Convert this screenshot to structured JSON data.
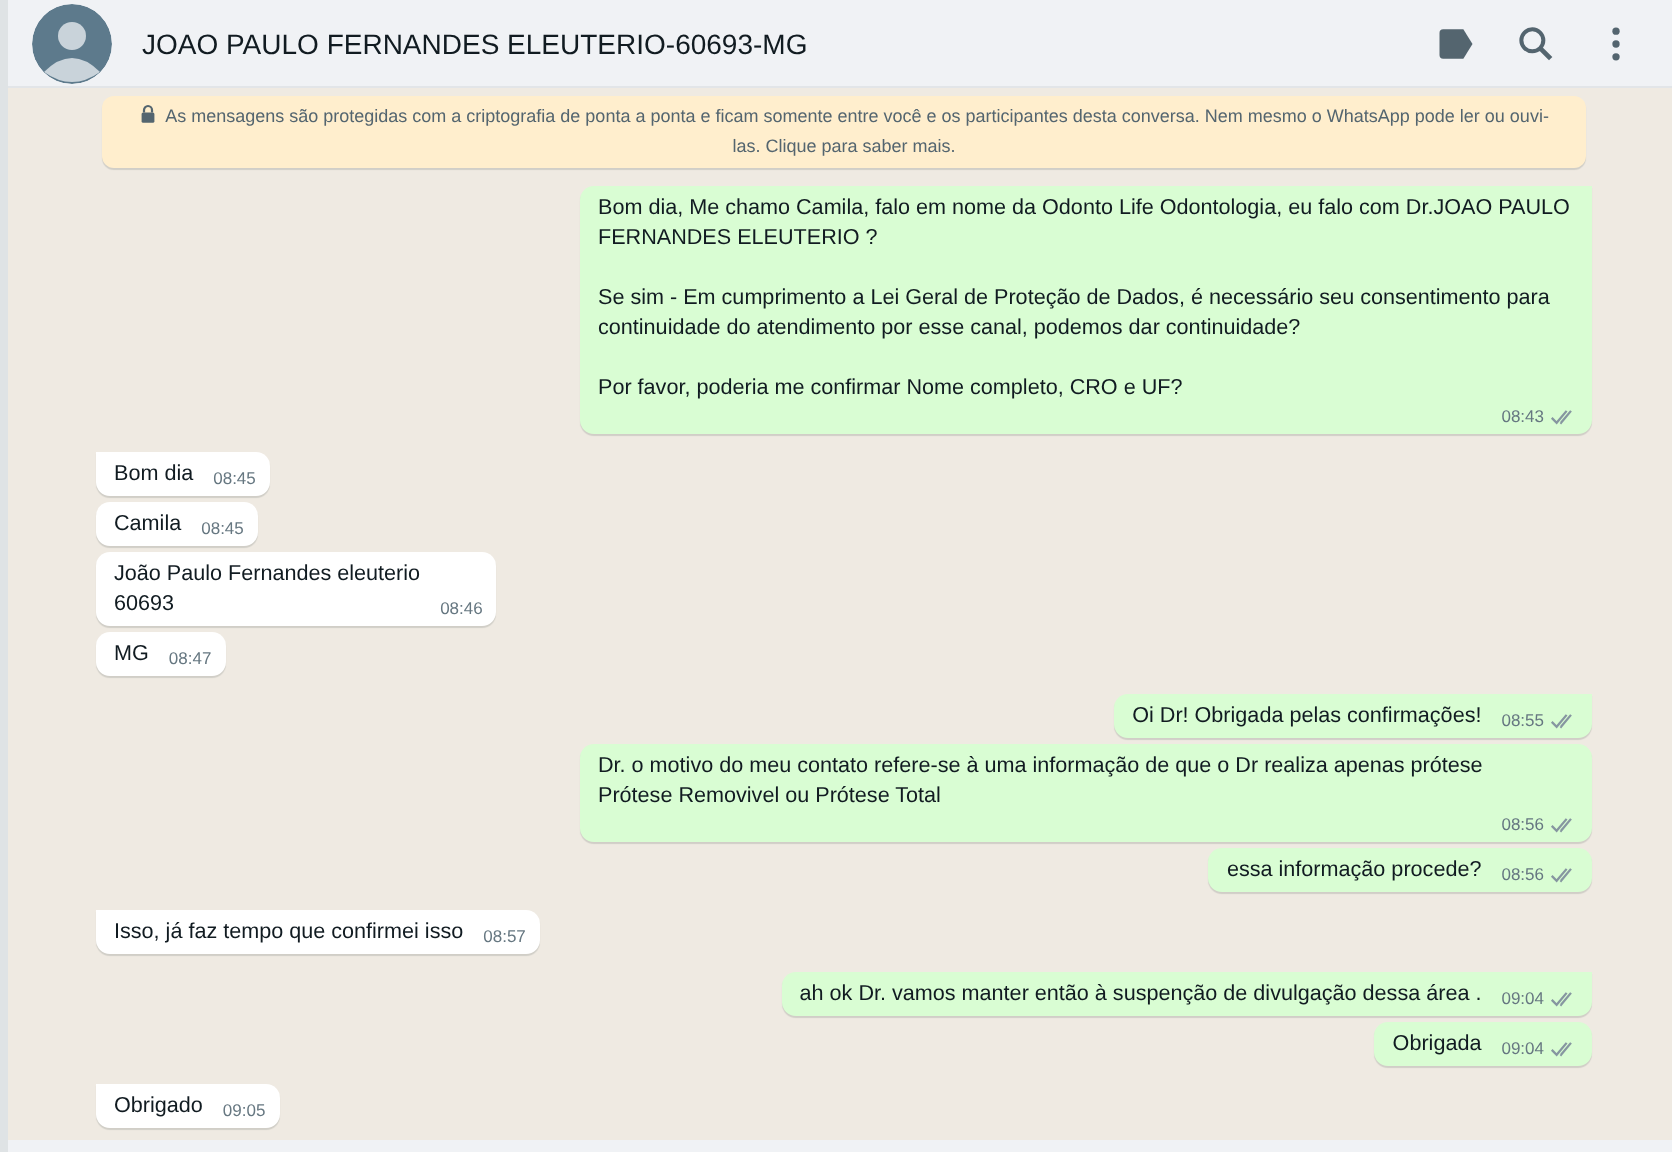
{
  "header": {
    "title": "JOAO PAULO FERNANDES ELEUTERIO-60693-MG"
  },
  "notice": {
    "text": "As mensagens são protegidas com a criptografia de ponta a ponta e ficam somente entre você e os participantes desta conversa. Nem mesmo o WhatsApp pode ler ou ouvi-las. Clique para saber mais."
  },
  "messages": [
    {
      "kind": "outgoing",
      "tail": true,
      "text": "Bom dia, Me chamo Camila, falo em nome da Odonto Life Odontologia, eu falo com Dr.JOAO PAULO FERNANDES ELEUTERIO ?\n\nSe sim - Em cumprimento a Lei Geral de Proteção de Dados, é necessário seu consentimento para continuidade do atendimento por esse canal, podemos dar continuidade?\n\nPor favor, poderia me confirmar Nome completo, CRO e UF?",
      "time": "08:43"
    },
    {
      "kind": "incoming",
      "tail": true,
      "text": "Bom dia",
      "time": "08:45"
    },
    {
      "kind": "incoming",
      "tail": false,
      "text": "Camila",
      "time": "08:45"
    },
    {
      "kind": "incoming",
      "tail": false,
      "text": "João Paulo Fernandes eleuterio\n60693",
      "time": "08:46"
    },
    {
      "kind": "incoming",
      "tail": false,
      "text": "MG",
      "time": "08:47"
    },
    {
      "kind": "outgoing",
      "tail": true,
      "text": "Oi Dr! Obrigada pelas confirmações!",
      "time": "08:55"
    },
    {
      "kind": "outgoing",
      "tail": false,
      "text": "Dr. o motivo do meu contato refere-se à uma informação de que o Dr realiza apenas prótese\nPrótese Removivel ou Prótese Total",
      "time": "08:56"
    },
    {
      "kind": "outgoing",
      "tail": false,
      "text": "essa informação procede?",
      "time": "08:56"
    },
    {
      "kind": "incoming",
      "tail": true,
      "text": "Isso, já faz tempo que confirmei isso",
      "time": "08:57"
    },
    {
      "kind": "outgoing",
      "tail": true,
      "text": "ah ok Dr. vamos manter então à suspenção de divulgação dessa área .",
      "time": "09:04"
    },
    {
      "kind": "outgoing",
      "tail": false,
      "text": "Obrigada",
      "time": "09:04"
    },
    {
      "kind": "incoming",
      "tail": true,
      "text": "Obrigado",
      "time": "09:05"
    }
  ]
}
